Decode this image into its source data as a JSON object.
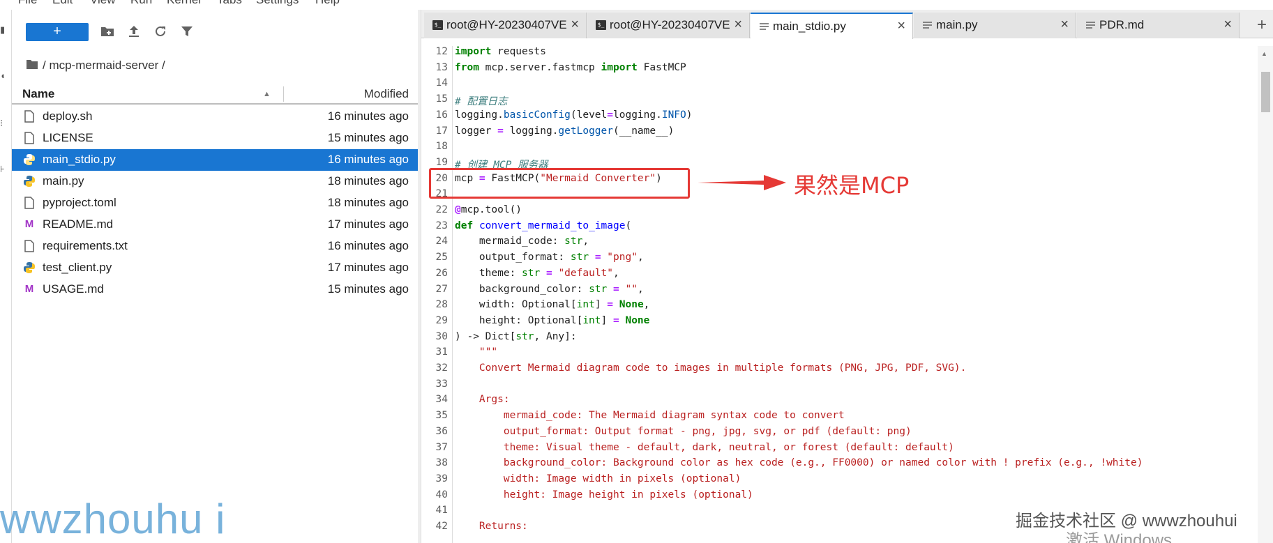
{
  "menubar": {
    "items": [
      "File",
      "Edit",
      "View",
      "Run",
      "Kernel",
      "Tabs",
      "Settings",
      "Help"
    ]
  },
  "toolbar": {
    "new_label": "+",
    "icons": [
      "new-folder-icon",
      "upload-icon",
      "refresh-icon",
      "filter-icon"
    ]
  },
  "breadcrumb": {
    "path": "/ mcp-mermaid-server /"
  },
  "file_browser": {
    "columns": [
      "Name",
      "Modified"
    ],
    "files": [
      {
        "name": "deploy.sh",
        "modified": "16 minutes ago",
        "icon": "file-icon"
      },
      {
        "name": "LICENSE",
        "modified": "15 minutes ago",
        "icon": "file-icon"
      },
      {
        "name": "main_stdio.py",
        "modified": "16 minutes ago",
        "icon": "python-icon",
        "selected": true
      },
      {
        "name": "main.py",
        "modified": "18 minutes ago",
        "icon": "python-icon"
      },
      {
        "name": "pyproject.toml",
        "modified": "18 minutes ago",
        "icon": "file-icon"
      },
      {
        "name": "README.md",
        "modified": "17 minutes ago",
        "icon": "markdown-icon"
      },
      {
        "name": "requirements.txt",
        "modified": "16 minutes ago",
        "icon": "file-icon"
      },
      {
        "name": "test_client.py",
        "modified": "17 minutes ago",
        "icon": "python-icon"
      },
      {
        "name": "USAGE.md",
        "modified": "15 minutes ago",
        "icon": "markdown-icon"
      }
    ]
  },
  "tabs": [
    {
      "label": "root@HY-20230407VE",
      "icon": "terminal-icon",
      "active": false
    },
    {
      "label": "root@HY-20230407VE",
      "icon": "terminal-icon",
      "active": false
    },
    {
      "label": "main_stdio.py",
      "icon": "text-file-icon",
      "active": true
    },
    {
      "label": "main.py",
      "icon": "text-file-icon",
      "active": false
    },
    {
      "label": "PDR.md",
      "icon": "text-file-icon",
      "active": false
    }
  ],
  "code_lines": [
    {
      "n": "12",
      "t": "import requests"
    },
    {
      "n": "13",
      "t": "from mcp.server.fastmcp import FastMCP"
    },
    {
      "n": "14",
      "t": ""
    },
    {
      "n": "15",
      "t": "# 配置日志"
    },
    {
      "n": "16",
      "t": "logging.basicConfig(level=logging.INFO)"
    },
    {
      "n": "17",
      "t": "logger = logging.getLogger(__name__)"
    },
    {
      "n": "18",
      "t": ""
    },
    {
      "n": "19",
      "t": "# 创建 MCP 服务器"
    },
    {
      "n": "20",
      "t": "mcp = FastMCP(\"Mermaid Converter\")"
    },
    {
      "n": "21",
      "t": ""
    },
    {
      "n": "22",
      "t": "@mcp.tool()"
    },
    {
      "n": "23",
      "t": "def convert_mermaid_to_image("
    },
    {
      "n": "24",
      "t": "    mermaid_code: str,"
    },
    {
      "n": "25",
      "t": "    output_format: str = \"png\","
    },
    {
      "n": "26",
      "t": "    theme: str = \"default\","
    },
    {
      "n": "27",
      "t": "    background_color: str = \"\","
    },
    {
      "n": "28",
      "t": "    width: Optional[int] = None,"
    },
    {
      "n": "29",
      "t": "    height: Optional[int] = None"
    },
    {
      "n": "30",
      "t": ") -> Dict[str, Any]:"
    },
    {
      "n": "31",
      "t": "    \"\"\""
    },
    {
      "n": "32",
      "t": "    Convert Mermaid diagram code to images in multiple formats (PNG, JPG, PDF, SVG)."
    },
    {
      "n": "33",
      "t": ""
    },
    {
      "n": "34",
      "t": "    Args:"
    },
    {
      "n": "35",
      "t": "        mermaid_code: The Mermaid diagram syntax code to convert"
    },
    {
      "n": "36",
      "t": "        output_format: Output format - png, jpg, svg, or pdf (default: png)"
    },
    {
      "n": "37",
      "t": "        theme: Visual theme - default, dark, neutral, or forest (default: default)"
    },
    {
      "n": "38",
      "t": "        background_color: Background color as hex code (e.g., FF0000) or named color with ! prefix (e.g., !white)"
    },
    {
      "n": "39",
      "t": "        width: Image width in pixels (optional)"
    },
    {
      "n": "40",
      "t": "        height: Image height in pixels (optional)"
    },
    {
      "n": "41",
      "t": ""
    },
    {
      "n": "42",
      "t": "    Returns:"
    }
  ],
  "annotation": {
    "text": "果然是MCP",
    "color": "#e53935"
  },
  "watermarks": {
    "left": "wwzhouhu i",
    "right": "掘金技术社区 @ wwwzhouhui",
    "windows": "激活 Windows"
  },
  "colors": {
    "accent": "#1976d2",
    "annotation": "#e53935"
  }
}
